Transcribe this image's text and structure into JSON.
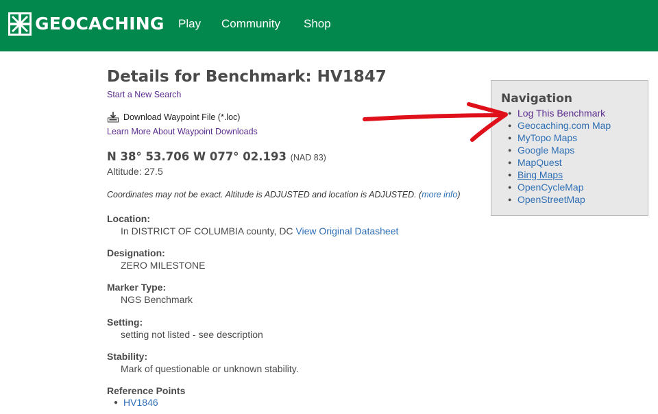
{
  "header": {
    "brand": "GEOCACHING",
    "nav": [
      "Play",
      "Community",
      "Shop"
    ],
    "bg_color": "#02874d"
  },
  "main": {
    "title": "Details for Benchmark: HV1847",
    "new_search": "Start a New Search",
    "download_label": "Download Waypoint File (*.loc)",
    "learn_more": "Learn More About Waypoint Downloads",
    "coordinates": "N 38° 53.706 W 077° 02.193",
    "datum": "(NAD 83)",
    "altitude": "Altitude: 27.5",
    "note_text": "Coordinates may not be exact. Altitude is ADJUSTED and location is ADJUSTED. (",
    "note_link": "more info",
    "note_end": ")",
    "location_label": "Location:",
    "location_value": "In DISTRICT OF COLUMBIA county, DC",
    "datasheet_link": "View Original Datasheet",
    "designation_label": "Designation:",
    "designation_value": "ZERO MILESTONE",
    "marker_label": "Marker Type:",
    "marker_value": "NGS Benchmark",
    "setting_label": "Setting:",
    "setting_value": "setting not listed - see description",
    "stability_label": "Stability:",
    "stability_value": "Mark of questionable or unknown stability.",
    "refpoints_label": "Reference Points",
    "refpoints": [
      "HV1846"
    ]
  },
  "navigation": {
    "title": "Navigation",
    "items": [
      "Log This Benchmark",
      "Geocaching.com Map",
      "MyTopo Maps",
      "Google Maps",
      "MapQuest",
      "Bing Maps",
      "OpenCycleMap",
      "OpenStreetMap"
    ]
  },
  "colors": {
    "link_visited": "#5b2d8c",
    "link": "#2f6fb5",
    "annotation_arrow": "#e0101a"
  },
  "icons": {
    "logo": "geocaching-logo-icon",
    "download": "download-icon",
    "annotation": "red-arrow-annotation"
  }
}
